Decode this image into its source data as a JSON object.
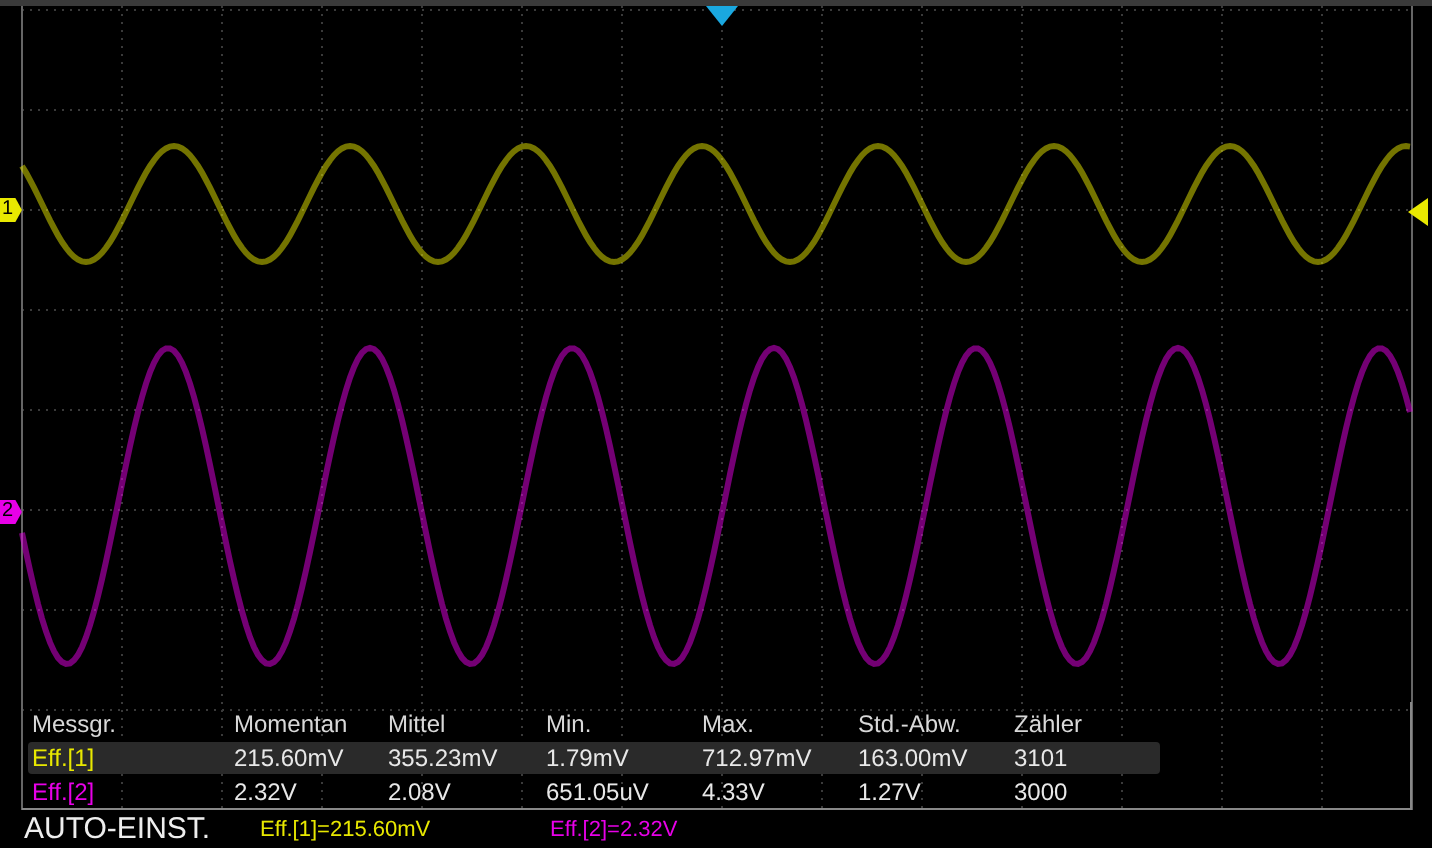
{
  "channels": [
    {
      "label": "1",
      "color": "#e8e800"
    },
    {
      "label": "2",
      "color": "#e800e8"
    }
  ],
  "measurements": {
    "columns": [
      "Messgr.",
      "Momentan",
      "Mittel",
      "Min.",
      "Max.",
      "Std.-Abw.",
      "Zähler"
    ],
    "rows": [
      {
        "color": "#e8e800",
        "selected": true,
        "cells": [
          "Eff.[1]",
          "215.60mV",
          "355.23mV",
          "1.79mV",
          "712.97mV",
          "163.00mV",
          "3101"
        ]
      },
      {
        "color": "#e800e8",
        "selected": false,
        "cells": [
          "Eff.[2]",
          "2.32V",
          "2.08V",
          "651.05uV",
          "4.33V",
          "1.27V",
          "3000"
        ]
      }
    ]
  },
  "status_bar": {
    "mode": "AUTO-EINST.",
    "readouts": [
      {
        "color": "#e8e800",
        "text": "Eff.[1]=215.60mV"
      },
      {
        "color": "#e800e8",
        "text": "Eff.[2]=2.32V"
      }
    ]
  }
}
